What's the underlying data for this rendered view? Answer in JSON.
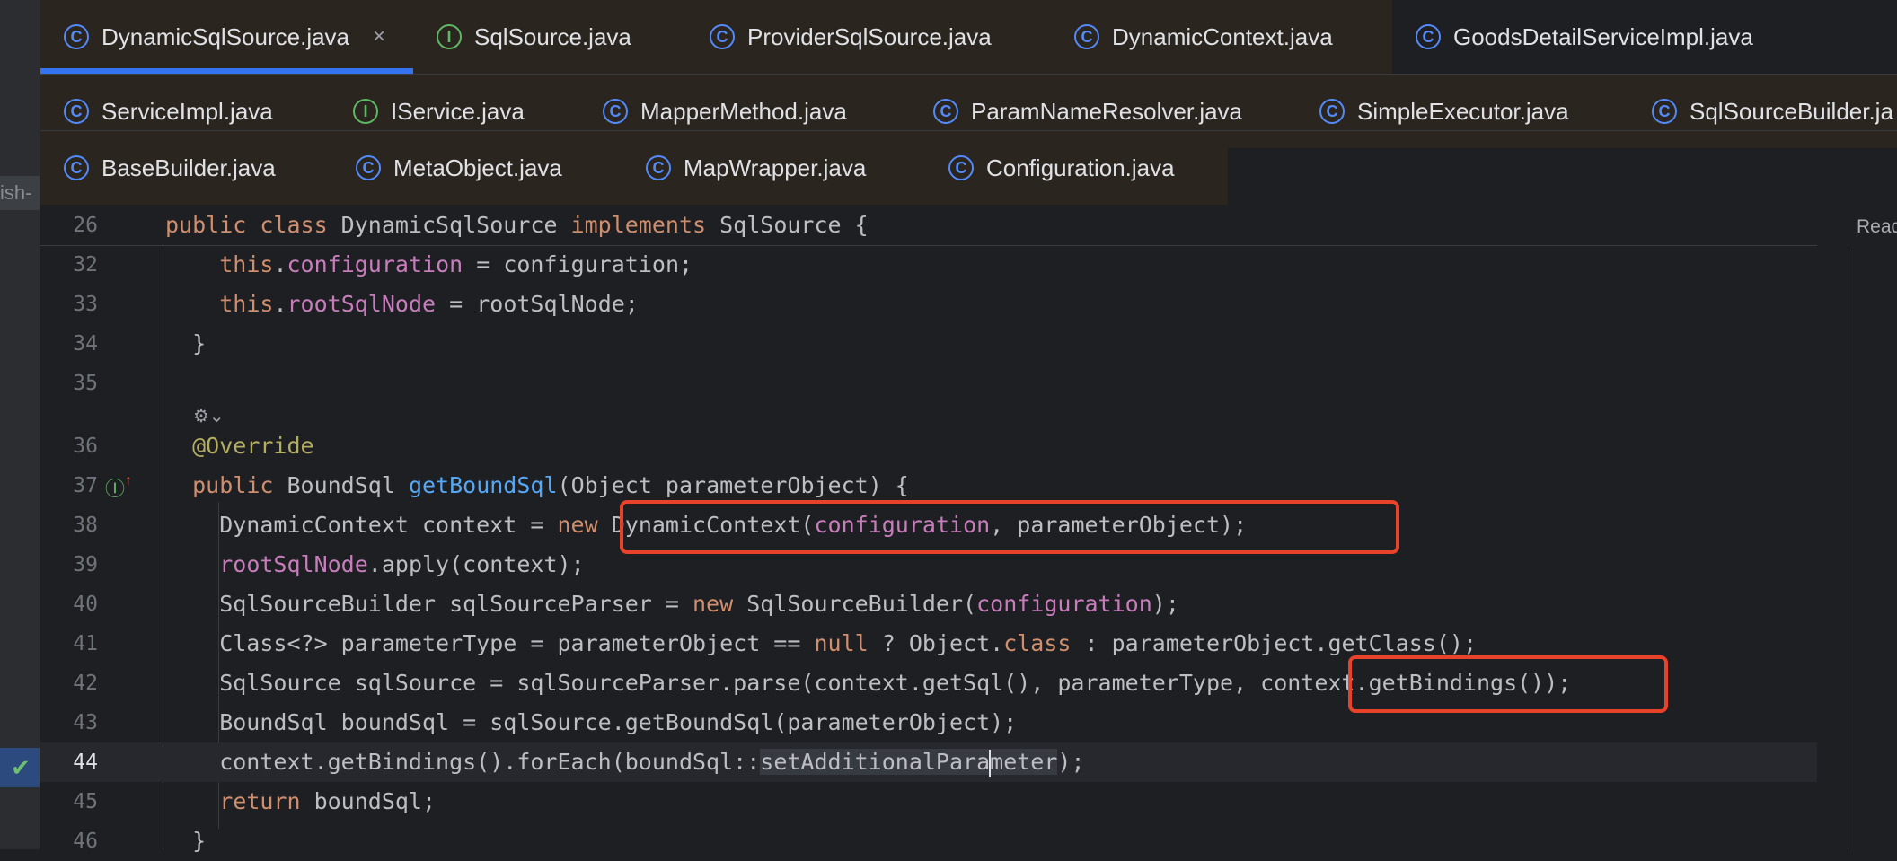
{
  "tabs": {
    "row1": [
      {
        "label": "DynamicSqlSource.java",
        "icon": "class-icon",
        "active": true,
        "close": "×"
      },
      {
        "label": "SqlSource.java",
        "icon": "interface-icon"
      },
      {
        "label": "ProviderSqlSource.java",
        "icon": "class-icon"
      },
      {
        "label": "DynamicContext.java",
        "icon": "class-icon"
      },
      {
        "label": "GoodsDetailServiceImpl.java",
        "icon": "class-icon"
      }
    ],
    "row2": [
      {
        "label": "ServiceImpl.java",
        "icon": "class-icon"
      },
      {
        "label": "IService.java",
        "icon": "interface-icon"
      },
      {
        "label": "MapperMethod.java",
        "icon": "class-icon"
      },
      {
        "label": "ParamNameResolver.java",
        "icon": "class-icon"
      },
      {
        "label": "SimpleExecutor.java",
        "icon": "class-icon"
      },
      {
        "label": "SqlSourceBuilder.ja",
        "icon": "class-icon"
      }
    ],
    "row3": [
      {
        "label": "BaseBuilder.java",
        "icon": "class-icon"
      },
      {
        "label": "MetaObject.java",
        "icon": "class-icon"
      },
      {
        "label": "MapWrapper.java",
        "icon": "class-icon"
      },
      {
        "label": "Configuration.java",
        "icon": "class-icon"
      }
    ]
  },
  "icon_glyphs": {
    "class": "C",
    "interface": "I"
  },
  "left_panel": {
    "tab_fragment": "ish-"
  },
  "editor": {
    "reader_mode": "Read",
    "sticky": {
      "line": "26",
      "code": "public class DynamicSqlSource implements SqlSource {"
    },
    "lines": [
      {
        "n": "32",
        "code": "    this.configuration = configuration;"
      },
      {
        "n": "33",
        "code": "    this.rootSqlNode = rootSqlNode;"
      },
      {
        "n": "34",
        "code": "  }"
      },
      {
        "n": "35",
        "code": ""
      },
      {
        "n": "36",
        "code": "  @Override"
      },
      {
        "n": "37",
        "code": "  public BoundSql getBoundSql(Object parameterObject) {"
      },
      {
        "n": "38",
        "code": "    DynamicContext context = new DynamicContext(configuration, parameterObject);"
      },
      {
        "n": "39",
        "code": "    rootSqlNode.apply(context);"
      },
      {
        "n": "40",
        "code": "    SqlSourceBuilder sqlSourceParser = new SqlSourceBuilder(configuration);"
      },
      {
        "n": "41",
        "code": "    Class<?> parameterType = parameterObject == null ? Object.class : parameterObject.getClass();"
      },
      {
        "n": "42",
        "code": "    SqlSource sqlSource = sqlSourceParser.parse(context.getSql(), parameterType, context.getBindings());"
      },
      {
        "n": "43",
        "code": "    BoundSql boundSql = sqlSource.getBoundSql(parameterObject);"
      },
      {
        "n": "44",
        "code": "    context.getBindings().forEach(boundSql::setAdditionalParameter);",
        "current": true
      },
      {
        "n": "45",
        "code": "    return boundSql;"
      },
      {
        "n": "46",
        "code": "  }"
      }
    ]
  },
  "colors": {
    "keyword": "#cf8e6d",
    "field": "#c77dbb",
    "annotation": "#b3ae60",
    "method": "#56a8f5",
    "highlight_box": "#e8432a",
    "active_tab_underline": "#3574f0"
  }
}
